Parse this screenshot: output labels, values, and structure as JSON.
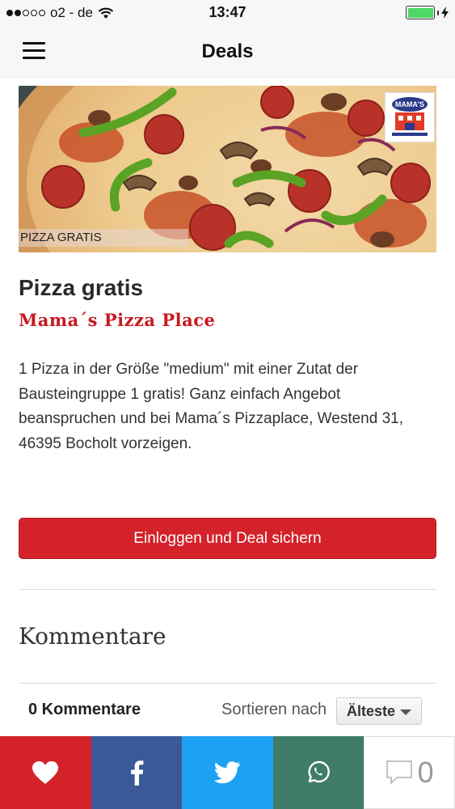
{
  "status_bar": {
    "carrier": "o2 - de",
    "time": "13:47",
    "signal_bars": 2,
    "battery_color": "#4cd964"
  },
  "nav": {
    "title": "Deals",
    "menu_icon": "hamburger-icon"
  },
  "hero": {
    "caption": "PIZZA GRATIS",
    "logo_icon": "mamas-pizza-place-logo"
  },
  "deal": {
    "title": "Pizza gratis",
    "merchant": "Mama´s Pizza Place",
    "description": "1 Pizza in der Größe \"medium\" mit einer Zutat der Bausteingruppe 1 gratis! Ganz einfach Angebot beanspruchen und bei Mama´s Pizzaplace, Westend 31, 46395 Bocholt vorzeigen.",
    "cta_label": "Einloggen und Deal sichern"
  },
  "comments": {
    "section_title": "Kommentare",
    "count_label": "0 Kommentare",
    "sort_label": "Sortieren nach",
    "sort_selected": "Älteste"
  },
  "share_bar": {
    "comment_count": "0",
    "buttons": [
      {
        "icon": "heart-icon",
        "color": "#d3222a"
      },
      {
        "icon": "facebook-icon",
        "color": "#3b5998"
      },
      {
        "icon": "twitter-icon",
        "color": "#1da1f2"
      },
      {
        "icon": "whatsapp-icon",
        "color": "#3f7d68"
      },
      {
        "icon": "comment-bubble-icon",
        "color": "#ffffff"
      }
    ]
  },
  "colors": {
    "brand_red": "#d3222a",
    "merchant_red": "#c8191f"
  }
}
